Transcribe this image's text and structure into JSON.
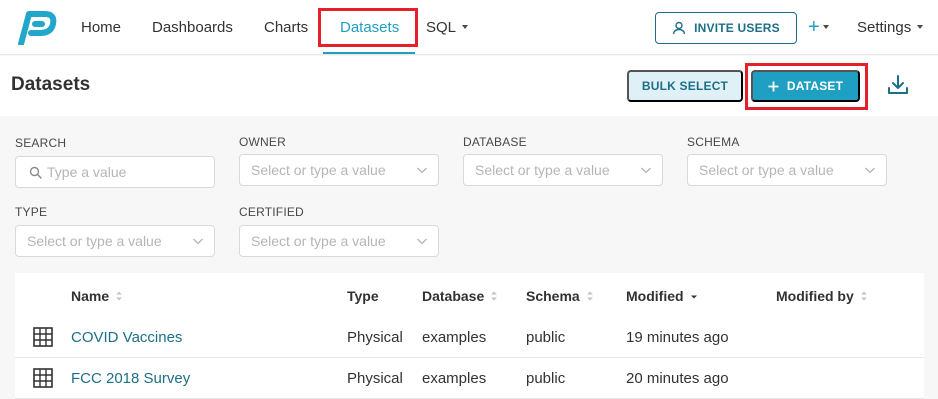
{
  "nav": {
    "items": [
      {
        "label": "Home"
      },
      {
        "label": "Dashboards"
      },
      {
        "label": "Charts"
      },
      {
        "label": "Datasets"
      },
      {
        "label": "SQL"
      }
    ],
    "active_index": 3,
    "invite_label": "INVITE USERS",
    "plus_label": "+",
    "settings_label": "Settings"
  },
  "header": {
    "title": "Datasets",
    "bulk_select_label": "BULK SELECT",
    "add_dataset_label": "DATASET"
  },
  "filters": [
    {
      "label": "SEARCH",
      "placeholder": "Type a value"
    },
    {
      "label": "OWNER",
      "placeholder": "Select or type a value"
    },
    {
      "label": "DATABASE",
      "placeholder": "Select or type a value"
    },
    {
      "label": "SCHEMA",
      "placeholder": "Select or type a value"
    },
    {
      "label": "TYPE",
      "placeholder": "Select or type a value"
    },
    {
      "label": "CERTIFIED",
      "placeholder": "Select or type a value"
    }
  ],
  "table": {
    "columns": [
      "Name",
      "Type",
      "Database",
      "Schema",
      "Modified",
      "Modified by"
    ],
    "rows": [
      {
        "name": "COVID Vaccines",
        "type": "Physical",
        "database": "examples",
        "schema": "public",
        "modified": "19 minutes ago",
        "modified_by": ""
      },
      {
        "name": "FCC 2018 Survey",
        "type": "Physical",
        "database": "examples",
        "schema": "public",
        "modified": "20 minutes ago",
        "modified_by": ""
      }
    ]
  },
  "colors": {
    "accent": "#1f9fc2",
    "accent_dark": "#1c6f86",
    "highlight": "#e4202c",
    "logo": "#20a7c9"
  },
  "icons": {
    "logo": "superset-logo-icon",
    "invite": "user-icon",
    "download": "download-icon",
    "search": "search-icon",
    "row": "table-grid-icon"
  }
}
